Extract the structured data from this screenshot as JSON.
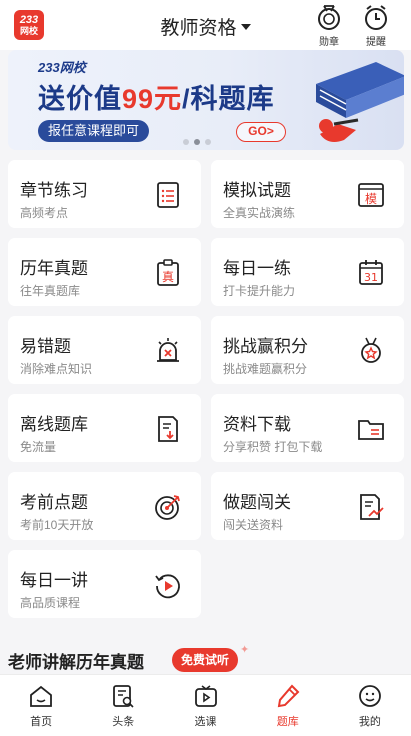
{
  "header": {
    "logo_line1": "233",
    "logo_line2": "网校",
    "title": "教师资格",
    "medal_label": "勋章",
    "reminder_label": "提醒"
  },
  "banner": {
    "brand": "233网校",
    "headline_part1": "送价值",
    "headline_highlight": "99元",
    "headline_part2": "/科题库",
    "sub": "报任意课程即可",
    "go": "GO>",
    "dot_count": 3,
    "active_dot": 1
  },
  "cards": [
    {
      "title": "章节练习",
      "sub": "高频考点",
      "icon": "list-doc-icon"
    },
    {
      "title": "模拟试题",
      "sub": "全真实战演练",
      "icon": "mock-exam-icon",
      "icon_text": "模"
    },
    {
      "title": "历年真题",
      "sub": "往年真题库",
      "icon": "clipboard-icon",
      "icon_text": "真"
    },
    {
      "title": "每日一练",
      "sub": "打卡提升能力",
      "icon": "calendar-icon",
      "icon_text": "31"
    },
    {
      "title": "易错题",
      "sub": "消除难点知识",
      "icon": "alarm-icon"
    },
    {
      "title": "挑战赢积分",
      "sub": "挑战难题赢积分",
      "icon": "medal-icon"
    },
    {
      "title": "离线题库",
      "sub": "免流量",
      "icon": "download-doc-icon"
    },
    {
      "title": "资料下载",
      "sub": "分享积赞 打包下载",
      "icon": "folder-icon"
    },
    {
      "title": "考前点题",
      "sub": "考前10天开放",
      "icon": "target-icon"
    },
    {
      "title": "做题闯关",
      "sub": "闯关送资料",
      "icon": "doc-chart-icon"
    },
    {
      "title": "每日一讲",
      "sub": "高品质课程",
      "icon": "replay-icon"
    }
  ],
  "section": {
    "title": "老师讲解历年真题",
    "badge": "免费试听"
  },
  "tabbar": {
    "items": [
      {
        "label": "首页",
        "icon": "home-icon"
      },
      {
        "label": "头条",
        "icon": "news-icon"
      },
      {
        "label": "选课",
        "icon": "course-icon"
      },
      {
        "label": "题库",
        "icon": "pencil-icon",
        "active": true
      },
      {
        "label": "我的",
        "icon": "profile-icon"
      }
    ]
  },
  "colors": {
    "accent": "#e8392d",
    "brand_blue": "#1c3a88",
    "background": "#f5f5f7"
  }
}
